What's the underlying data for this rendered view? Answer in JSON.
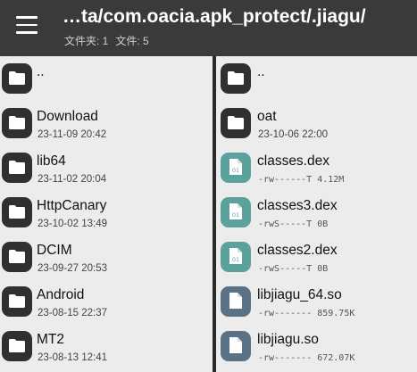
{
  "header": {
    "path": "…ta/com.oacia.apk_protect/.jiagu/",
    "folders_text": "文件夹: 1",
    "files_text": "文件: 5"
  },
  "left_pane": [
    {
      "name": "..",
      "meta": "",
      "type": "folder"
    },
    {
      "name": "Download",
      "meta": "23-11-09 20:42",
      "type": "folder"
    },
    {
      "name": "lib64",
      "meta": "23-11-02 20:04",
      "type": "folder"
    },
    {
      "name": "HttpCanary",
      "meta": "23-10-02 13:49",
      "type": "folder"
    },
    {
      "name": "DCIM",
      "meta": "23-09-27 20:53",
      "type": "folder"
    },
    {
      "name": "Android",
      "meta": "23-08-15 22:37",
      "type": "folder"
    },
    {
      "name": "MT2",
      "meta": "23-08-13 12:41",
      "type": "folder"
    }
  ],
  "right_pane": [
    {
      "name": "..",
      "meta": "",
      "type": "folder"
    },
    {
      "name": "oat",
      "meta": "23-10-06 22:00",
      "type": "folder"
    },
    {
      "name": "classes.dex",
      "meta": "-rw------T 4.12M",
      "type": "dex"
    },
    {
      "name": "classes3.dex",
      "meta": "-rwS-----T 0B",
      "type": "dex"
    },
    {
      "name": "classes2.dex",
      "meta": "-rwS-----T 0B",
      "type": "dex"
    },
    {
      "name": "libjiagu_64.so",
      "meta": "-rw------- 859.75K",
      "type": "so"
    },
    {
      "name": "libjiagu.so",
      "meta": "-rw------- 672.07K",
      "type": "so"
    }
  ],
  "colors": {
    "folder_icon": "#303030",
    "dex_icon": "#5ba19c",
    "so_icon": "#5b7186",
    "topbar": "#3a3a3a"
  },
  "icons": {
    "menu": "menu-icon",
    "folder": "folder-icon",
    "dex": "dex-file-icon",
    "so": "so-file-icon"
  }
}
